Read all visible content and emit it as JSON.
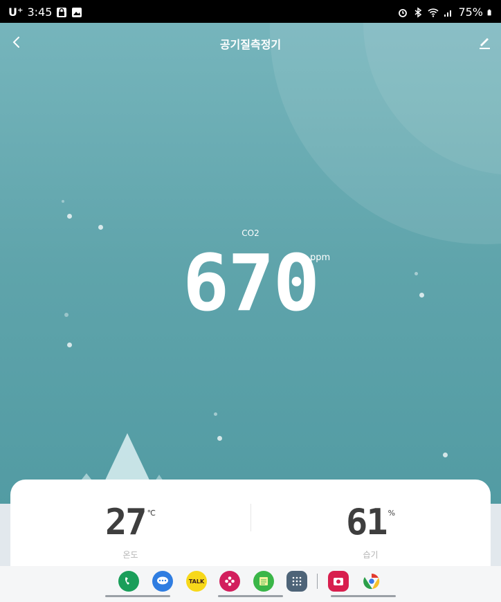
{
  "status_bar": {
    "carrier": "U⁺",
    "time": "3:45",
    "battery": "75%",
    "icons": [
      "lock-icon",
      "gallery-icon",
      "alarm-icon",
      "bluetooth-icon",
      "wifi-icon",
      "signal-icon",
      "battery-icon"
    ]
  },
  "header": {
    "title": "공기질측정기",
    "back_icon": "back-chevron-icon",
    "edit_icon": "edit-pencil-icon"
  },
  "co2": {
    "label": "CO2",
    "value": "670",
    "unit": "ppm"
  },
  "metrics": {
    "temperature": {
      "value": "27",
      "unit": "℃",
      "label": "온도"
    },
    "humidity": {
      "value": "61",
      "unit": "%",
      "label": "습기"
    }
  },
  "dock": {
    "apps": [
      {
        "name": "phone",
        "icon": "phone-icon",
        "color": "#1a9e5a"
      },
      {
        "name": "messages",
        "icon": "message-icon",
        "color": "#2f7de1"
      },
      {
        "name": "kakaotalk",
        "icon": "talk-icon",
        "text": "TALK",
        "color": "#f7d81a"
      },
      {
        "name": "gallery",
        "icon": "flower-icon",
        "color": "#d21f5d"
      },
      {
        "name": "notes",
        "icon": "notes-icon",
        "color": "#3ab648"
      },
      {
        "name": "apps",
        "icon": "app-grid-icon",
        "color": "#4e6478"
      },
      {
        "name": "camera",
        "icon": "camera-icon",
        "color": "#d81f4e"
      },
      {
        "name": "chrome",
        "icon": "chrome-icon",
        "color": "#e8eaed"
      }
    ]
  },
  "colors": {
    "background_top": "#76b5bc",
    "background_bottom": "#4f99a1",
    "card": "#ffffff",
    "value_text": "#3e3e3e",
    "label_text": "#b4b4b4"
  }
}
